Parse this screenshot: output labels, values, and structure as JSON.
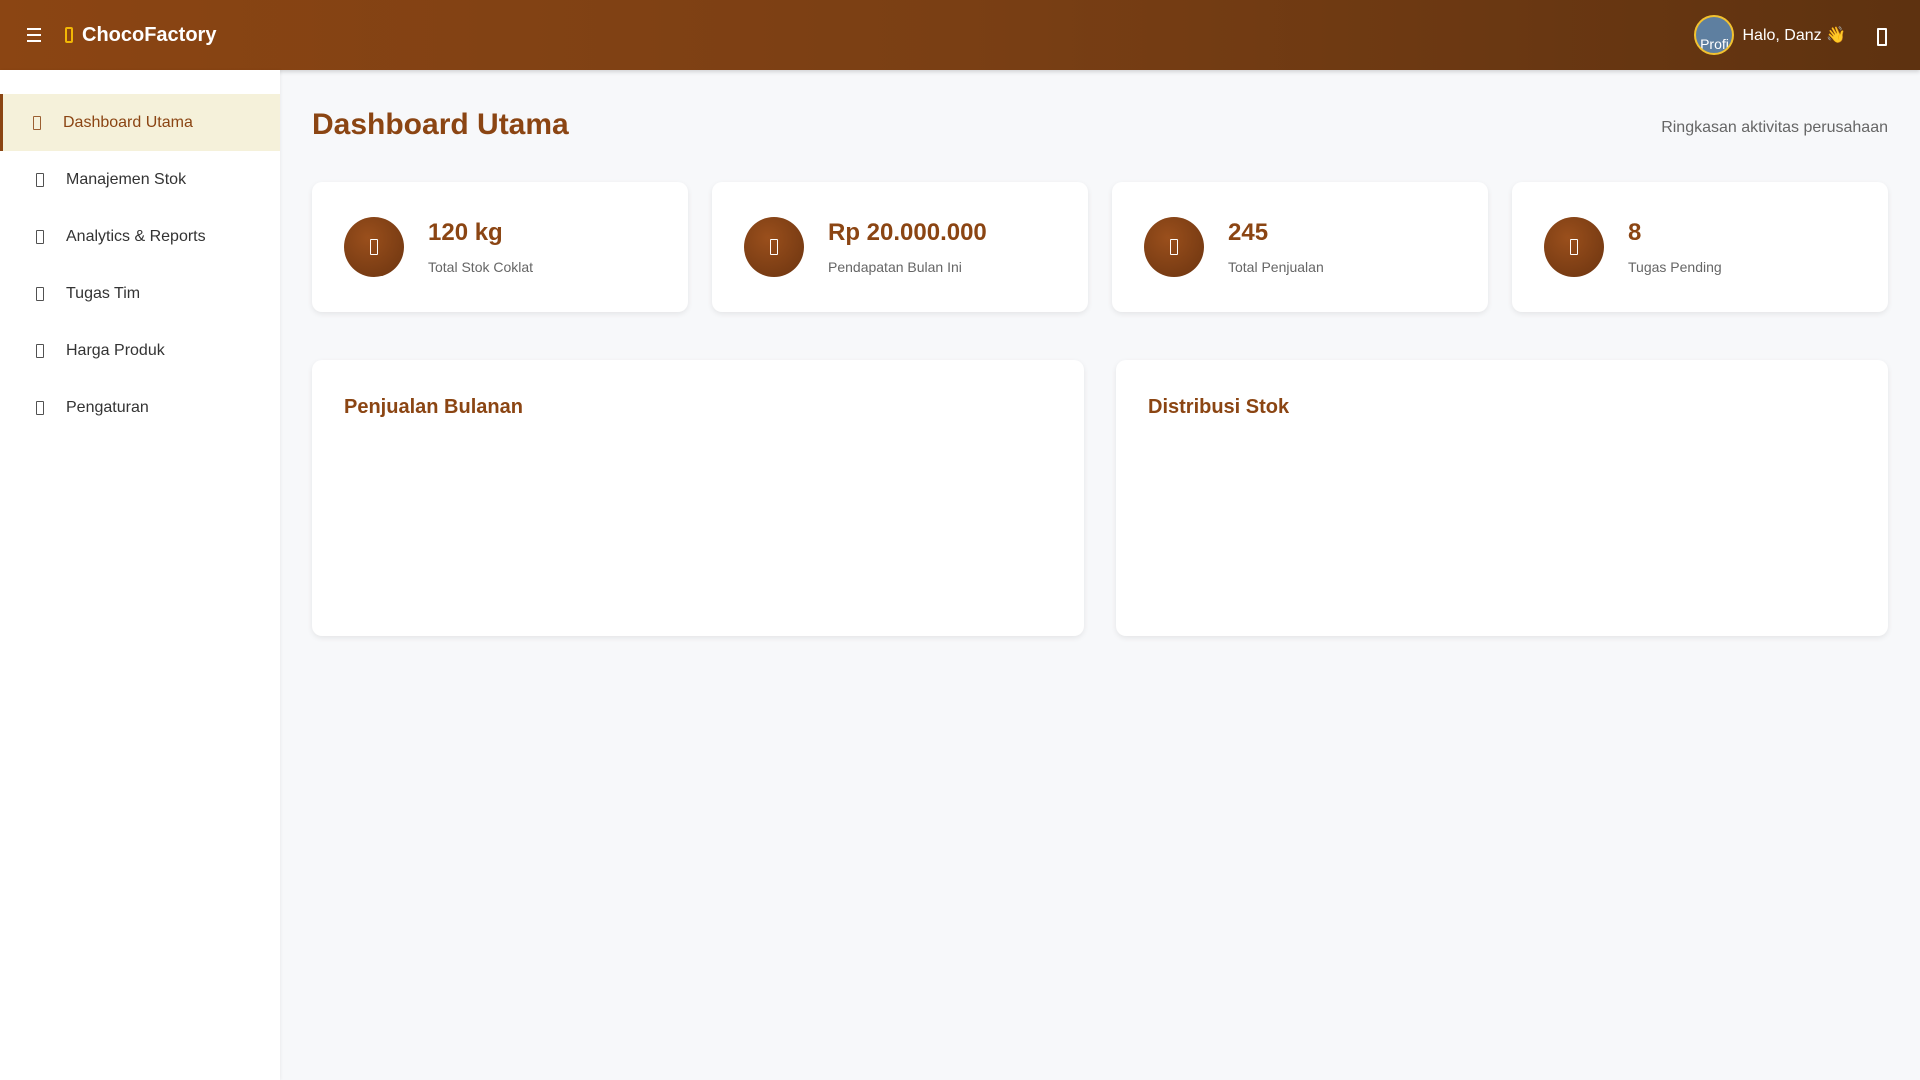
{
  "header": {
    "brand": "ChocoFactory",
    "avatar_alt": "Profi",
    "greeting": "Halo, Danz 👋"
  },
  "sidebar": {
    "items": [
      {
        "label": "Dashboard Utama",
        "icon": "dashboard-icon",
        "active": true
      },
      {
        "label": "Manajemen Stok",
        "icon": "box-icon",
        "active": false
      },
      {
        "label": "Analytics & Reports",
        "icon": "chart-icon",
        "active": false
      },
      {
        "label": "Tugas Tim",
        "icon": "tasks-icon",
        "active": false
      },
      {
        "label": "Harga Produk",
        "icon": "tag-icon",
        "active": false
      },
      {
        "label": "Pengaturan",
        "icon": "gear-icon",
        "active": false
      }
    ]
  },
  "main": {
    "title": "Dashboard Utama",
    "subtitle": "Ringkasan aktivitas perusahaan",
    "stats": [
      {
        "value": "120 kg",
        "label": "Total Stok Coklat",
        "icon": "cube-icon"
      },
      {
        "value": "Rp 20.000.000",
        "label": "Pendapatan Bulan Ini",
        "icon": "money-icon"
      },
      {
        "value": "245",
        "label": "Total Penjualan",
        "icon": "cart-icon"
      },
      {
        "value": "8",
        "label": "Tugas Pending",
        "icon": "clock-icon"
      }
    ],
    "panels": [
      {
        "title": "Penjualan Bulanan"
      },
      {
        "title": "Distribusi Stok"
      }
    ]
  },
  "colors": {
    "brand": "#8b4513",
    "accent": "#f2b705",
    "active_bg": "#f5f1da"
  }
}
